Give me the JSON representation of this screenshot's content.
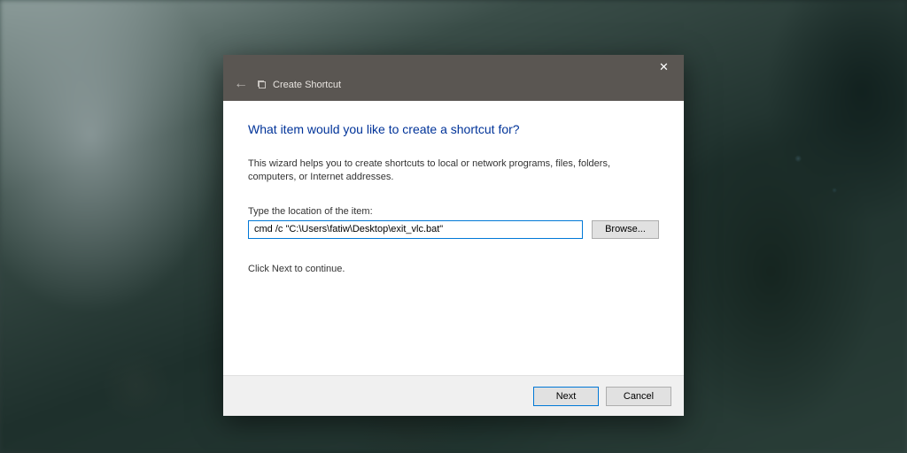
{
  "dialog": {
    "title": "Create Shortcut",
    "heading": "What item would you like to create a shortcut for?",
    "description": "This wizard helps you to create shortcuts to local or network programs, files, folders, computers, or Internet addresses.",
    "field_label": "Type the location of the item:",
    "location_value": "cmd /c \"C:\\Users\\fatiw\\Desktop\\exit_vlc.bat\"",
    "browse_label": "Browse...",
    "continue_text": "Click Next to continue.",
    "next_label": "Next",
    "cancel_label": "Cancel"
  }
}
